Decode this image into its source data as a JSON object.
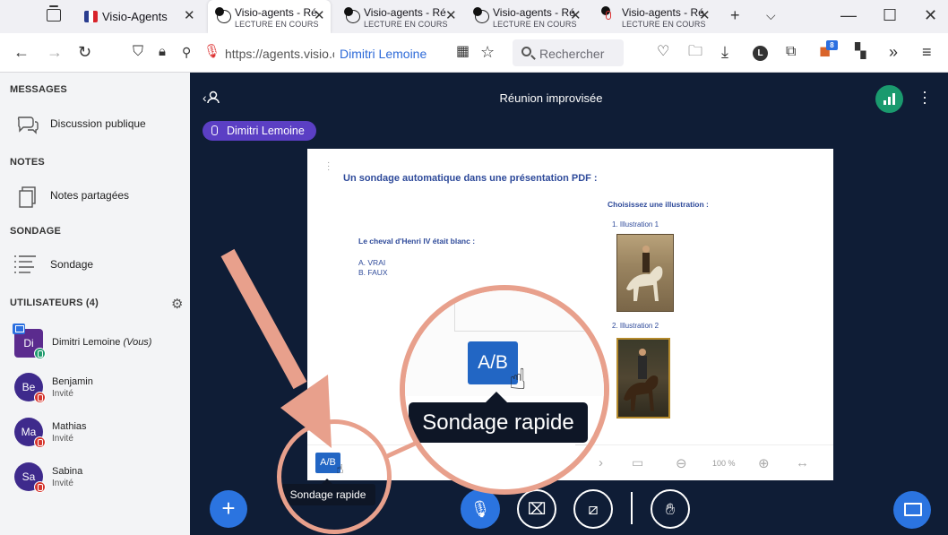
{
  "browser": {
    "tabs": [
      {
        "title": "Visio-Agents",
        "subtitle": "",
        "favicon": "flag-icon"
      },
      {
        "title": "Visio-agents - Ré",
        "subtitle": "LECTURE EN COURS",
        "favicon": "globe-icon"
      },
      {
        "title": "Visio-agents - Ré",
        "subtitle": "LECTURE EN COURS",
        "favicon": "globe-icon"
      },
      {
        "title": "Visio-agents - Ré",
        "subtitle": "LECTURE EN COURS",
        "favicon": "globe-icon"
      },
      {
        "title": "Visio-agents - Ré",
        "subtitle": "LECTURE EN COURS",
        "favicon": "mic-icon"
      }
    ],
    "url": "https://agents.visio.c",
    "url_highlight": "Dimitri Lemoine",
    "search_placeholder": "Rechercher",
    "extension_badge": "8",
    "profile_initial": "L"
  },
  "sidebar": {
    "messages_title": "MESSAGES",
    "public_chat": "Discussion publique",
    "notes_title": "NOTES",
    "shared_notes": "Notes partagées",
    "poll_title": "SONDAGE",
    "poll": "Sondage",
    "users_title": "UTILISATEURS (4)",
    "users": [
      {
        "initials": "Di",
        "name": "Dimitri Lemoine",
        "suffix": "(Vous)",
        "role": "",
        "mic": "on",
        "presenter": true
      },
      {
        "initials": "Be",
        "name": "Benjamin",
        "suffix": "",
        "role": "Invité",
        "mic": "off",
        "presenter": false
      },
      {
        "initials": "Ma",
        "name": "Mathias",
        "suffix": "",
        "role": "Invité",
        "mic": "off",
        "presenter": false
      },
      {
        "initials": "Sa",
        "name": "Sabina",
        "suffix": "",
        "role": "Invité",
        "mic": "off",
        "presenter": false
      }
    ]
  },
  "meeting": {
    "title": "Réunion improvisée",
    "speaker": "Dimitri Lemoine"
  },
  "slide": {
    "title": "Un sondage automatique dans une présentation PDF :",
    "question": "Le cheval d'Henri IV était blanc :",
    "answers": [
      "A. VRAI",
      "B. FAUX"
    ],
    "choose": "Choisissez une illustration :",
    "illustrations": [
      "1.    Illustration 1",
      "2.    Illustration 2"
    ],
    "zoom": "100 %",
    "quick_poll_button": "A/B"
  },
  "tooltip": {
    "label": "Sondage rapide"
  },
  "colors": {
    "accent": "#2b74e0",
    "dark_bg": "#0f1d36",
    "speaker_pill": "#5b3fc4",
    "annotation": "#e8a08c"
  }
}
